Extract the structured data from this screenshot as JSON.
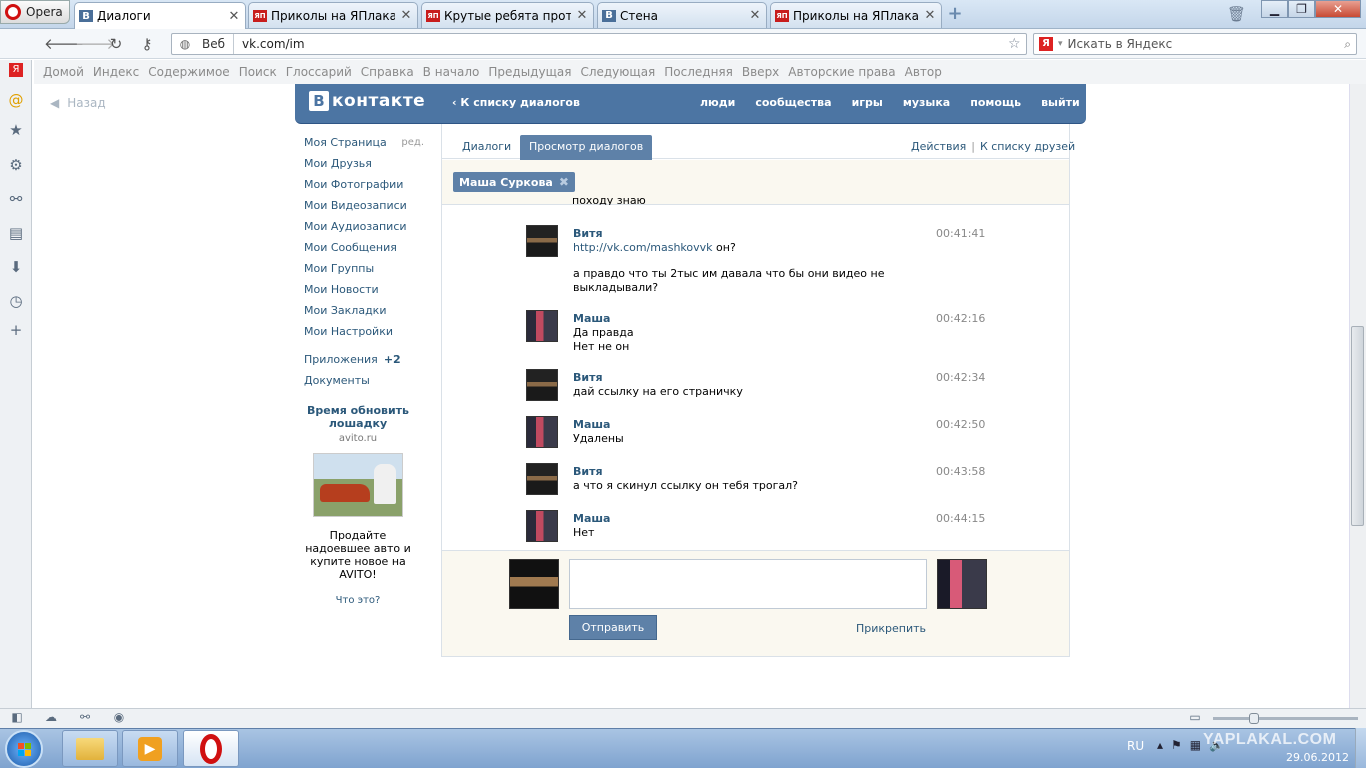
{
  "browser": {
    "menu_label": "Opera",
    "tabs": [
      {
        "title": "Диалоги",
        "favicon": "vk",
        "active": true
      },
      {
        "title": "Приколы на ЯПлакалъ",
        "favicon": "ЯП"
      },
      {
        "title": "Крутые ребята против...",
        "favicon": "ЯП"
      },
      {
        "title": "Стена",
        "favicon": "vk"
      },
      {
        "title": "Приколы на ЯПлакал...",
        "favicon": "ЯП"
      }
    ],
    "address": {
      "scope": "Веб",
      "url": "vk.com/im"
    },
    "search_placeholder": "Искать в Яндекс",
    "nav_toolbar": [
      "Домой",
      "Индекс",
      "Содержимое",
      "Поиск",
      "Глоссарий",
      "Справка",
      "В начало",
      "Предыдущая",
      "Следующая",
      "Последняя",
      "Вверх",
      "Авторские права",
      "Автор"
    ]
  },
  "page": {
    "back_label": "Назад",
    "logo_text": "контакте",
    "logo_letter": "В",
    "to_dialog_list": "К списку диалогов",
    "top_nav": [
      "люди",
      "сообщества",
      "игры",
      "музыка",
      "помощь",
      "выйти"
    ],
    "left_menu": {
      "my_page": "Моя Страница",
      "edit": "ред.",
      "items": [
        "Мои Друзья",
        "Мои Фотографии",
        "Мои Видеозаписи",
        "Мои Аудиозаписи",
        "Мои Сообщения",
        "Мои Группы",
        "Мои Новости",
        "Мои Закладки",
        "Мои Настройки"
      ],
      "apps": "Приложения",
      "apps_badge": "+2",
      "docs": "Документы"
    },
    "ad": {
      "title": "Время обновить лошадку",
      "domain": "avito.ru",
      "text": "Продайте надоевшее авто и купите новое на AVITO!",
      "what": "Что это?"
    },
    "tabs": {
      "dialogs": "Диалоги",
      "view": "Просмотр диалогов"
    },
    "actions": {
      "actions": "Действия",
      "sep": "|",
      "to_friends": "К списку друзей"
    },
    "peer_name": "Маша Суркова",
    "partial_text": "походу знаю",
    "messages": [
      {
        "author": "Витя",
        "time": "00:41:41",
        "link": "http://vk.com/mashkovvk",
        "lines": [
          "он?",
          "а правдо что ты 2тыс им давала что бы они видео не выкладывали?"
        ]
      },
      {
        "author": "Маша",
        "time": "00:42:16",
        "lines": [
          "Да правда",
          "Нет не он"
        ]
      },
      {
        "author": "Витя",
        "time": "00:42:34",
        "lines": [
          "дай ссылку на его страничку"
        ]
      },
      {
        "author": "Маша",
        "time": "00:42:50",
        "lines": [
          "Удалены"
        ]
      },
      {
        "author": "Витя",
        "time": "00:43:58",
        "lines": [
          "а что я скинул ссылку он тебя трогал?"
        ]
      },
      {
        "author": "Маша",
        "time": "00:44:15",
        "lines": [
          "Нет"
        ]
      }
    ],
    "compose": {
      "send": "Отправить",
      "attach": "Прикрепить"
    }
  },
  "taskbar": {
    "lang": "RU",
    "date": "29.06.2012",
    "watermark": "YAPLAKAL.COM"
  },
  "colors": {
    "vk_blue": "#4c75a3",
    "vk_link": "#2b587a",
    "tab_active": "#5e81a8",
    "opera_red": "#d01010"
  }
}
